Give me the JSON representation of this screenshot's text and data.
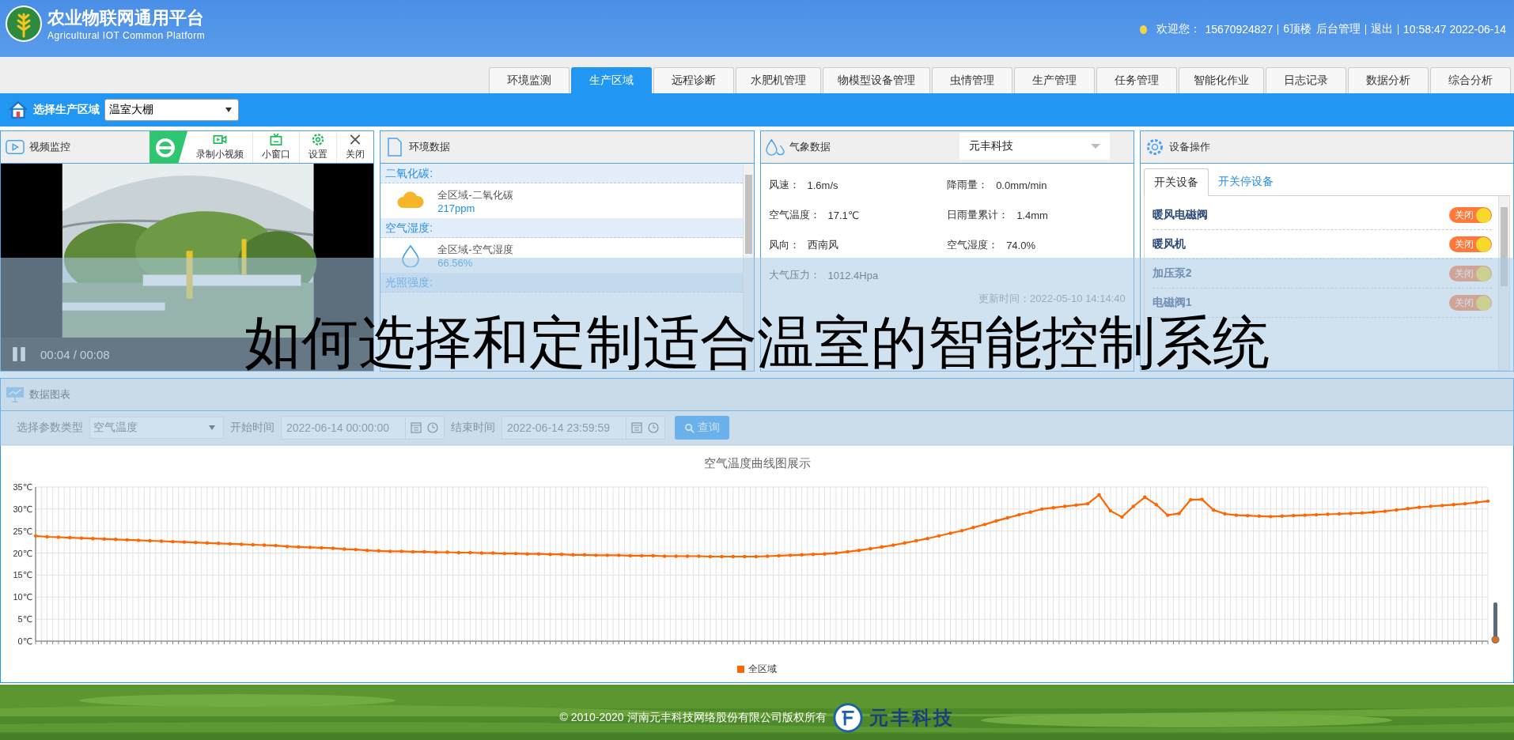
{
  "header": {
    "title": "农业物联网通用平台",
    "subtitle": "Agricultural IOT Common Platform",
    "welcome": "欢迎您：",
    "phone": "15670924827",
    "org": "6顶楼",
    "admin_link": "后台管理",
    "logout_link": "退出",
    "clock": "10:58:47 2022-06-14"
  },
  "nav_tabs": [
    {
      "label": "环境监测",
      "selected": false
    },
    {
      "label": "生产区域",
      "selected": true
    },
    {
      "label": "远程诊断",
      "selected": false
    },
    {
      "label": "水肥机管理",
      "selected": false
    },
    {
      "label": "物模型设备管理",
      "selected": false
    },
    {
      "label": "虫情管理",
      "selected": false
    },
    {
      "label": "生产管理",
      "selected": false
    },
    {
      "label": "任务管理",
      "selected": false
    },
    {
      "label": "智能化作业",
      "selected": false
    },
    {
      "label": "日志记录",
      "selected": false
    },
    {
      "label": "数据分析",
      "selected": false
    },
    {
      "label": "综合分析",
      "selected": false
    }
  ],
  "area_bar": {
    "label": "选择生产区域",
    "value": "温室大棚"
  },
  "video_panel": {
    "title": "视频监控",
    "tools": [
      {
        "kind": "record",
        "label": "录制小视频"
      },
      {
        "kind": "window",
        "label": "小窗口"
      },
      {
        "kind": "settings",
        "label": "设置"
      },
      {
        "kind": "close",
        "label": "关闭"
      }
    ],
    "time": "00:04 / 00:08"
  },
  "env_panel": {
    "title": "环境数据",
    "sections": [
      {
        "title": "二氧化碳:",
        "items": [
          {
            "kind": "co2",
            "name": "全区域-二氧化碳",
            "value": "217ppm"
          }
        ]
      },
      {
        "title": "空气湿度:",
        "items": [
          {
            "kind": "humidity",
            "name": "全区域-空气湿度",
            "value": "66.56%"
          }
        ]
      },
      {
        "title": "光照强度:"
      }
    ]
  },
  "weather_panel": {
    "title": "气象数据",
    "source": "元丰科技",
    "fields": [
      {
        "label": "风速：",
        "value": "1.6m/s"
      },
      {
        "label": "降雨量：",
        "value": "0.0mm/min"
      },
      {
        "label": "空气温度：",
        "value": "17.1℃"
      },
      {
        "label": "日雨量累计：",
        "value": "1.4mm"
      },
      {
        "label": "风向：",
        "value": "西南风"
      },
      {
        "label": "空气湿度：",
        "value": "74.0%"
      },
      {
        "label": "大气压力：",
        "value": "1012.4Hpa"
      }
    ],
    "updated": "更新时间：2022-05-10 14:14:40"
  },
  "device_panel": {
    "title": "设备操作",
    "tabs": [
      {
        "label": "开关设备",
        "selected": true
      },
      {
        "label": "开关停设备",
        "selected": false
      }
    ],
    "devices": [
      {
        "name": "暖风电磁阀",
        "on": true,
        "state_label": "关闭"
      },
      {
        "name": "暖风机",
        "on": true,
        "state_label": "关闭"
      },
      {
        "name": "加压泵2",
        "on": true,
        "state_label": "关闭"
      },
      {
        "name": "电磁阀1",
        "on": true,
        "state_label": "关闭"
      }
    ]
  },
  "chart_panel": {
    "title": "数据图表",
    "param_label": "选择参数类型",
    "param_value": "空气温度",
    "start_label": "开始时间",
    "start_value": "2022-06-14 00:00:00",
    "end_label": "结束时间",
    "end_value": "2022-06-14 23:59:59",
    "query_button": "查询",
    "chart_data": {
      "type": "line",
      "grid": true,
      "title": "空气温度曲线图展示",
      "ylim": [
        0,
        35
      ],
      "yticks": [
        {
          "value": 0,
          "label": "0℃"
        },
        {
          "value": 5,
          "label": "5℃"
        },
        {
          "value": 10,
          "label": "10℃"
        },
        {
          "value": 15,
          "label": "15℃"
        },
        {
          "value": 20,
          "label": "20℃"
        },
        {
          "value": 25,
          "label": "25℃"
        },
        {
          "value": 30,
          "label": "30℃"
        },
        {
          "value": 35,
          "label": "35℃"
        }
      ],
      "series": [
        {
          "name": "全区域",
          "color": "#ff6600",
          "values": [
            23.9,
            23.7,
            23.6,
            23.5,
            23.4,
            23.3,
            23.2,
            23.1,
            23.0,
            22.9,
            22.8,
            22.7,
            22.6,
            22.5,
            22.4,
            22.3,
            22.2,
            22.1,
            22.0,
            21.9,
            21.8,
            21.7,
            21.5,
            21.4,
            21.3,
            21.2,
            21.1,
            20.9,
            20.8,
            20.6,
            20.5,
            20.4,
            20.4,
            20.3,
            20.3,
            20.2,
            20.2,
            20.1,
            20.1,
            20.0,
            20.0,
            19.9,
            19.9,
            19.8,
            19.8,
            19.7,
            19.7,
            19.6,
            19.6,
            19.5,
            19.5,
            19.5,
            19.4,
            19.4,
            19.4,
            19.3,
            19.3,
            19.3,
            19.3,
            19.2,
            19.2,
            19.2,
            19.2,
            19.2,
            19.3,
            19.4,
            19.5,
            19.6,
            19.7,
            19.8,
            20.0,
            20.3,
            20.6,
            21.0,
            21.4,
            21.8,
            22.3,
            22.8,
            23.3,
            23.9,
            24.5,
            25.1,
            25.8,
            26.5,
            27.3,
            28.0,
            28.7,
            29.3,
            30.0,
            30.3,
            30.6,
            30.9,
            31.2,
            33.2,
            29.6,
            28.2,
            30.6,
            32.7,
            31.0,
            28.6,
            29.0,
            32.1,
            32.2,
            29.8,
            28.9,
            28.6,
            28.5,
            28.4,
            28.3,
            28.4,
            28.5,
            28.6,
            28.7,
            28.8,
            28.9,
            29.0,
            29.1,
            29.3,
            29.5,
            29.8,
            30.1,
            30.4,
            30.6,
            30.8,
            31.0,
            31.2,
            31.5,
            31.8
          ]
        }
      ]
    }
  },
  "footer": {
    "copyright": "© 2010-2020 河南元丰科技网络股份有限公司版权所有",
    "logo_text": "元丰科技"
  },
  "caption": "如何选择和定制适合温室的智能控制系统"
}
